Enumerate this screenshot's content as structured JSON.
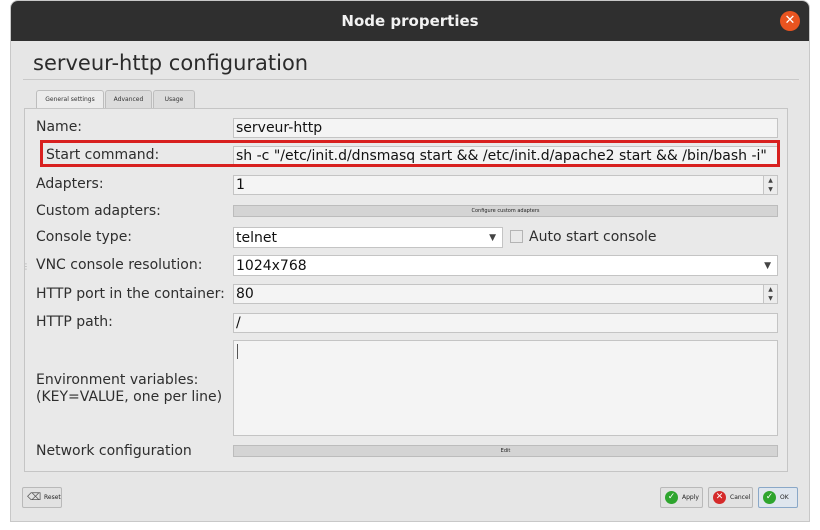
{
  "window": {
    "title": "Node properties"
  },
  "heading": "serveur-http configuration",
  "tabs": [
    {
      "label": "General settings",
      "active": true
    },
    {
      "label": "Advanced",
      "active": false
    },
    {
      "label": "Usage",
      "active": false
    }
  ],
  "form": {
    "name": {
      "label": "Name:",
      "value": "serveur-http"
    },
    "start_command": {
      "label": "Start command:",
      "value": "sh -c \"/etc/init.d/dnsmasq start && /etc/init.d/apache2 start && /bin/bash -i\""
    },
    "adapters": {
      "label": "Adapters:",
      "value": "1"
    },
    "custom_adapters": {
      "label": "Custom adapters:",
      "button": "Configure custom adapters"
    },
    "console_type": {
      "label": "Console type:",
      "value": "telnet",
      "auto_start_label": "Auto start console",
      "auto_start_checked": false
    },
    "vnc_resolution": {
      "label": "VNC console resolution:",
      "value": "1024x768"
    },
    "http_port": {
      "label": "HTTP port in the container:",
      "value": "80"
    },
    "http_path": {
      "label": "HTTP path:",
      "value": "/"
    },
    "env_vars": {
      "label_line1": "Environment variables:",
      "label_line2": "(KEY=VALUE, one per line)",
      "value": ""
    },
    "network": {
      "label": "Network configuration",
      "button": "Edit"
    }
  },
  "footer": {
    "reset": "Reset",
    "apply": "Apply",
    "cancel": "Cancel",
    "ok": "OK"
  },
  "colors": {
    "highlight": "#d8201f",
    "close": "#e95420",
    "ok_green": "#2ea52e",
    "cancel_red": "#d52a2a"
  }
}
